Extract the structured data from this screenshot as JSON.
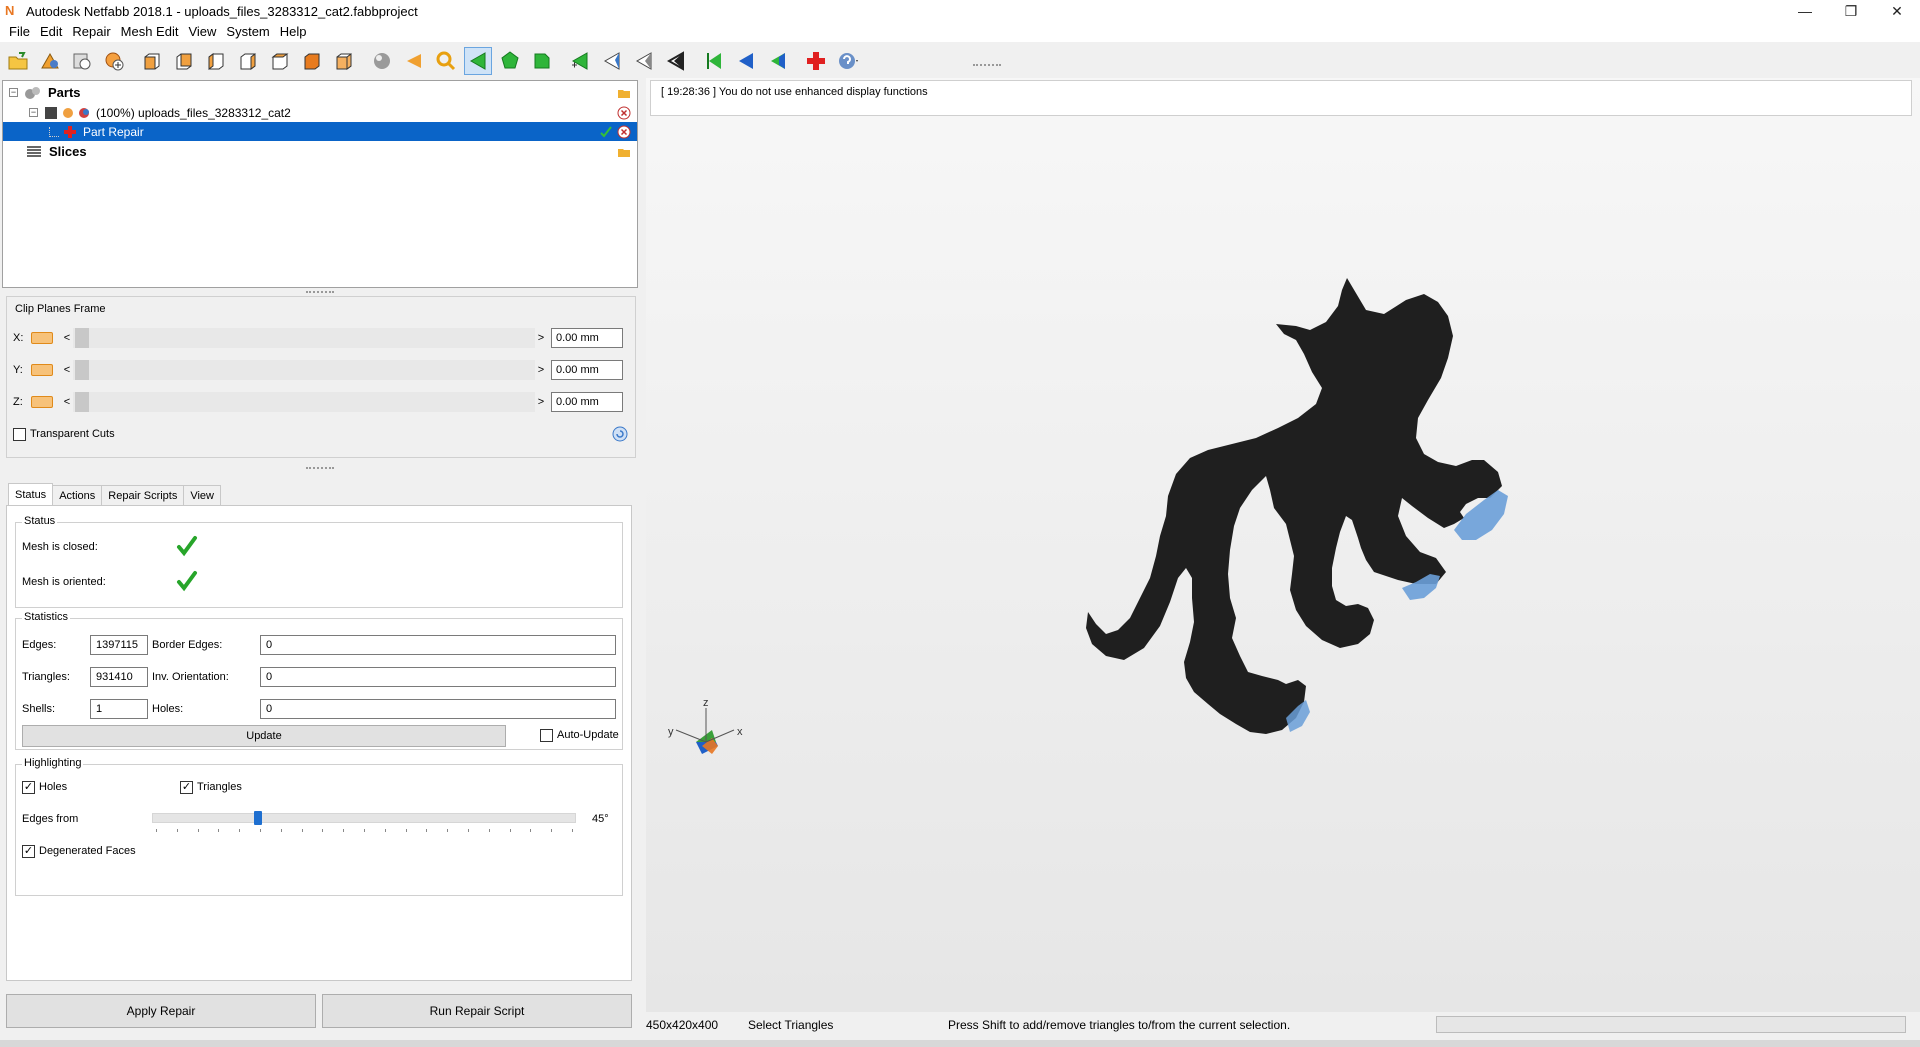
{
  "window": {
    "title": "Autodesk Netfabb 2018.1 - uploads_files_3283312_cat2.fabbproject",
    "app_letter": "N",
    "minimize": "—",
    "maximize": "❐",
    "close": "✕"
  },
  "menu": [
    "File",
    "Edit",
    "Repair",
    "Mesh Edit",
    "View",
    "System",
    "Help"
  ],
  "tree": {
    "parts_label": "Parts",
    "part_name": "(100%) uploads_files_3283312_cat2",
    "repair_label": "Part Repair",
    "slices_label": "Slices"
  },
  "clip": {
    "title": "Clip Planes Frame",
    "rows": [
      {
        "axis": "X:",
        "value": "0.00 mm"
      },
      {
        "axis": "Y:",
        "value": "0.00 mm"
      },
      {
        "axis": "Z:",
        "value": "0.00 mm"
      }
    ],
    "left_arrow": "<",
    "right_arrow": ">",
    "transparent_label": "Transparent Cuts"
  },
  "tabs": [
    "Status",
    "Actions",
    "Repair Scripts",
    "View"
  ],
  "status_group": {
    "title": "Status",
    "closed_label": "Mesh is closed:",
    "oriented_label": "Mesh is oriented:"
  },
  "statistics": {
    "title": "Statistics",
    "edges_label": "Edges:",
    "edges_value": "1397115",
    "border_edges_label": "Border Edges:",
    "border_edges_value": "0",
    "triangles_label": "Triangles:",
    "triangles_value": "931410",
    "inv_orientation_label": "Inv. Orientation:",
    "inv_orientation_value": "0",
    "shells_label": "Shells:",
    "shells_value": "1",
    "holes_label": "Holes:",
    "holes_value": "0",
    "update_label": "Update",
    "auto_update_label": "Auto-Update"
  },
  "highlighting": {
    "title": "Highlighting",
    "holes_label": "Holes",
    "triangles_label": "Triangles",
    "edges_from_label": "Edges from",
    "edges_from_value": "45°",
    "edges_from_fraction": 0.25,
    "degenerated_label": "Degenerated Faces"
  },
  "buttons": {
    "apply_repair": "Apply Repair",
    "run_script": "Run Repair Script"
  },
  "viewport": {
    "log": "[ 19:28:36 ] You do not use enhanced display functions",
    "axis_x": "x",
    "axis_y": "y",
    "axis_z": "z"
  },
  "statusbar": {
    "dimensions": "450x420x400",
    "mode": "Select Triangles",
    "hint": "Press Shift to add/remove triangles to/from the current selection."
  },
  "colors": {
    "selection": "#0a64c8",
    "model": "#1f1f1f",
    "highlight": "#6a9fd8",
    "check": "#27a52a"
  }
}
